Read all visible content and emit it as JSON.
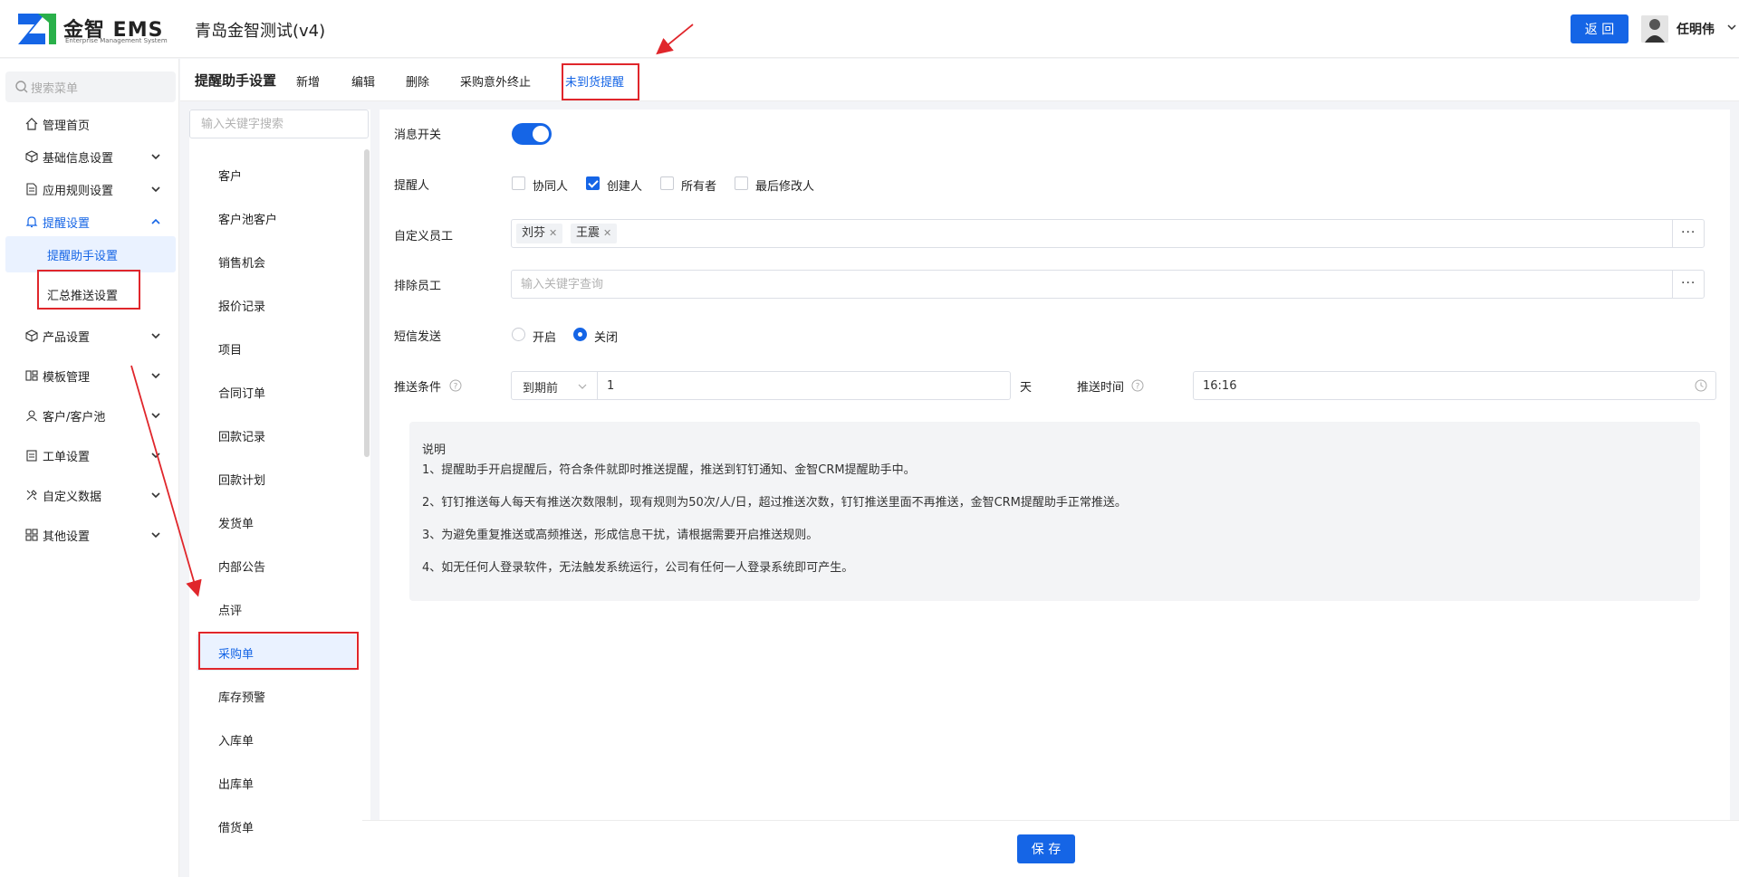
{
  "header": {
    "brand": "金智 EMS",
    "brand_sub": "Enterprise Management System",
    "app_title": "青岛金智测试(v4)",
    "back_label": "返 回",
    "user_name": "任明伟"
  },
  "sidebar": {
    "search_placeholder": "搜索菜单",
    "items": [
      {
        "label": "管理首页",
        "icon": "home-icon"
      },
      {
        "label": "基础信息设置",
        "icon": "cube-icon"
      },
      {
        "label": "应用规则设置",
        "icon": "document-icon"
      },
      {
        "label": "提醒设置",
        "icon": "bell-icon"
      },
      {
        "label": "产品设置",
        "icon": "box-icon"
      },
      {
        "label": "模板管理",
        "icon": "template-icon"
      },
      {
        "label": "客户/客户池",
        "icon": "user-icon"
      },
      {
        "label": "工单设置",
        "icon": "clipboard-icon"
      },
      {
        "label": "自定义数据",
        "icon": "tools-icon"
      },
      {
        "label": "其他设置",
        "icon": "grid-icon"
      }
    ],
    "sub_items": [
      {
        "label": "提醒助手设置"
      },
      {
        "label": "汇总推送设置"
      }
    ]
  },
  "tabs": {
    "title": "提醒助手设置",
    "items": [
      "新增",
      "编辑",
      "删除",
      "采购意外终止",
      "未到货提醒"
    ]
  },
  "list": {
    "search_placeholder": "输入关键字搜索",
    "items": [
      "客户",
      "客户池客户",
      "销售机会",
      "报价记录",
      "项目",
      "合同订单",
      "回款记录",
      "回款计划",
      "发货单",
      "内部公告",
      "点评",
      "采购单",
      "库存预警",
      "入库单",
      "出库单",
      "借货单"
    ]
  },
  "form": {
    "switch_label": "消息开关",
    "switch_on": true,
    "reminder_label": "提醒人",
    "reminders": [
      {
        "label": "协同人",
        "checked": false
      },
      {
        "label": "创建人",
        "checked": true
      },
      {
        "label": "所有者",
        "checked": false
      },
      {
        "label": "最后修改人",
        "checked": false
      }
    ],
    "custom_staff_label": "自定义员工",
    "custom_staff_tags": [
      "刘芬",
      "王震"
    ],
    "exclude_staff_label": "排除员工",
    "exclude_placeholder": "输入关键字查询",
    "sms_label": "短信发送",
    "sms_options": [
      {
        "label": "开启",
        "selected": false
      },
      {
        "label": "关闭",
        "selected": true
      }
    ],
    "condition_label": "推送条件",
    "condition_select": "到期前",
    "condition_value": "1",
    "condition_unit": "天",
    "time_label": "推送时间",
    "time_value": "16:16",
    "more_label": "···"
  },
  "notes": {
    "heading": "说明",
    "lines": [
      "1、提醒助手开启提醒后，符合条件就即时推送提醒，推送到钉钉通知、金智CRM提醒助手中。",
      "2、钉钉推送每人每天有推送次数限制，现有规则为50次/人/日，超过推送次数，钉钉推送里面不再推送，金智CRM提醒助手正常推送。",
      "3、为避免重复推送或高频推送，形成信息干扰，请根据需要开启推送规则。",
      "4、如无任何人登录软件，无法触发系统运行，公司有任何一人登录系统即可产生。"
    ]
  },
  "footer": {
    "save_label": "保 存"
  },
  "colors": {
    "accent": "#1565e6",
    "annotation": "#e0262b"
  }
}
